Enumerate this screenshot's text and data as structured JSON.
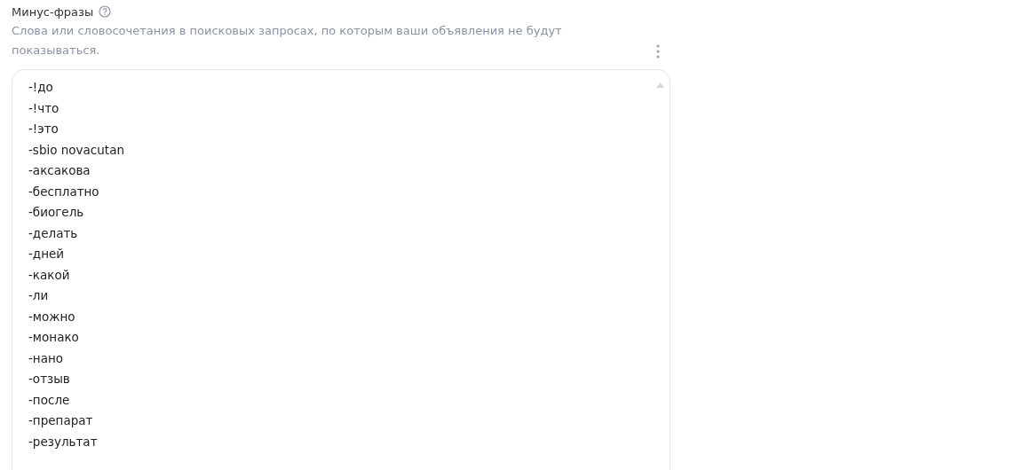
{
  "field": {
    "label": "Минус-фразы",
    "description": "Слова или словосочетания в поисковых запросах, по которым ваши объявления не будут показываться.",
    "phrases": [
      "-!до",
      "-!что",
      "-!это",
      "-sbio novacutan",
      "-аксакова",
      "-бесплатно",
      "-биогель",
      "-делать",
      "-дней",
      "-какой",
      "-ли",
      "-можно",
      "-монако",
      "-нано",
      "-отзыв",
      "-после",
      "-препарат",
      "-результат"
    ]
  }
}
